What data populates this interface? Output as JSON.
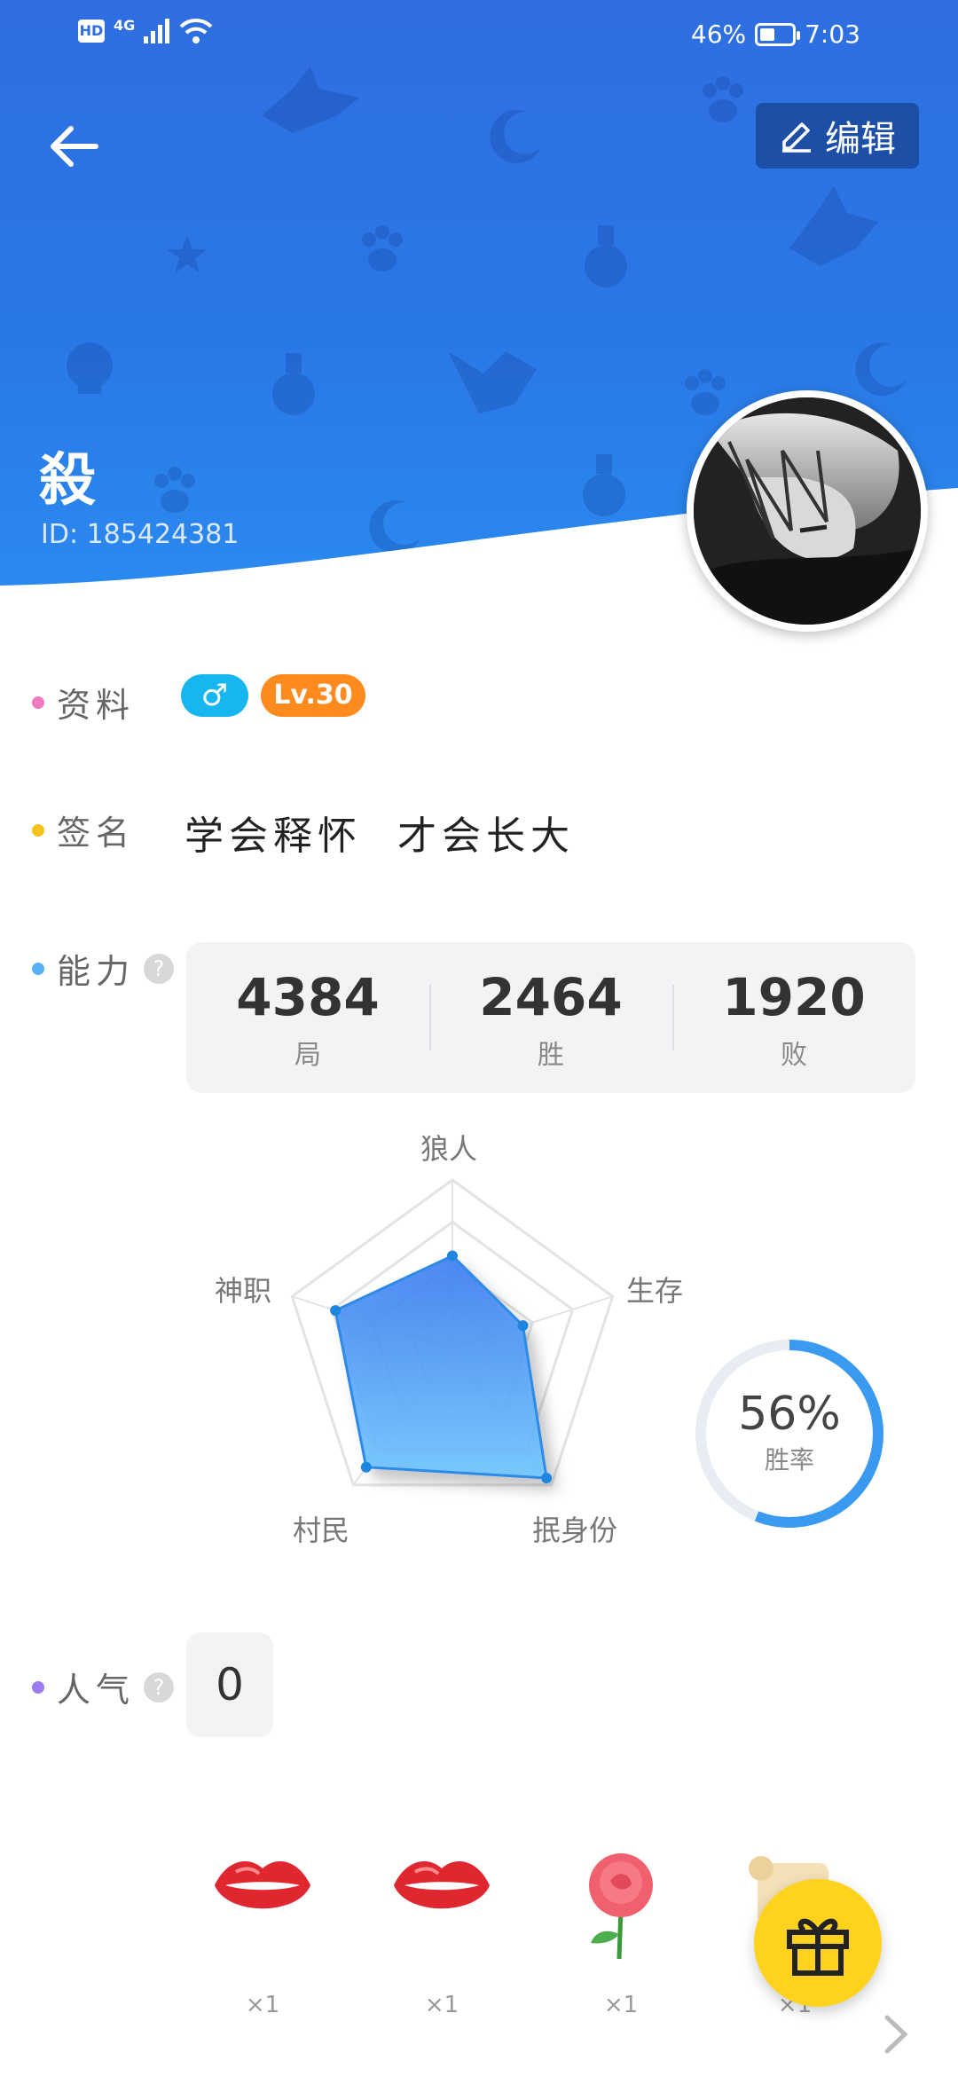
{
  "status_bar": {
    "hd": "HD",
    "network": "4G",
    "battery": "46%",
    "battery_level": 0.46,
    "time": "7:03"
  },
  "header": {
    "edit_label": "编辑",
    "user_name": "殺",
    "user_id": "ID: 185424381"
  },
  "profile": {
    "label": "资料",
    "gender_symbol": "♂",
    "level": "Lv.30"
  },
  "signature": {
    "label": "签名",
    "text": "学会释怀  才会长大"
  },
  "ability": {
    "label": "能力",
    "help": "?",
    "stats": [
      {
        "value": "4384",
        "label": "局"
      },
      {
        "value": "2464",
        "label": "胜"
      },
      {
        "value": "1920",
        "label": "败"
      }
    ],
    "radar": {
      "axes": [
        "狼人",
        "生存",
        "抿身份",
        "村民",
        "神职"
      ],
      "values": [
        0.55,
        0.44,
        0.95,
        0.87,
        0.73
      ]
    },
    "win_rate": {
      "value": "56%",
      "label": "胜率",
      "fraction": 0.56
    }
  },
  "popularity": {
    "label": "人气",
    "help": "?",
    "value": "0"
  },
  "gifts": [
    {
      "icon": "lips-icon",
      "count": "×1"
    },
    {
      "icon": "lips-icon",
      "count": "×1"
    },
    {
      "icon": "rose-icon",
      "count": "×1"
    },
    {
      "icon": "scroll-icon",
      "count": "×1"
    }
  ],
  "colors": {
    "header": "#2a78e6",
    "accent": "#3a9af0",
    "orange": "#ff8a1e",
    "gender": "#18b6f0",
    "fab": "#ffd21e"
  }
}
